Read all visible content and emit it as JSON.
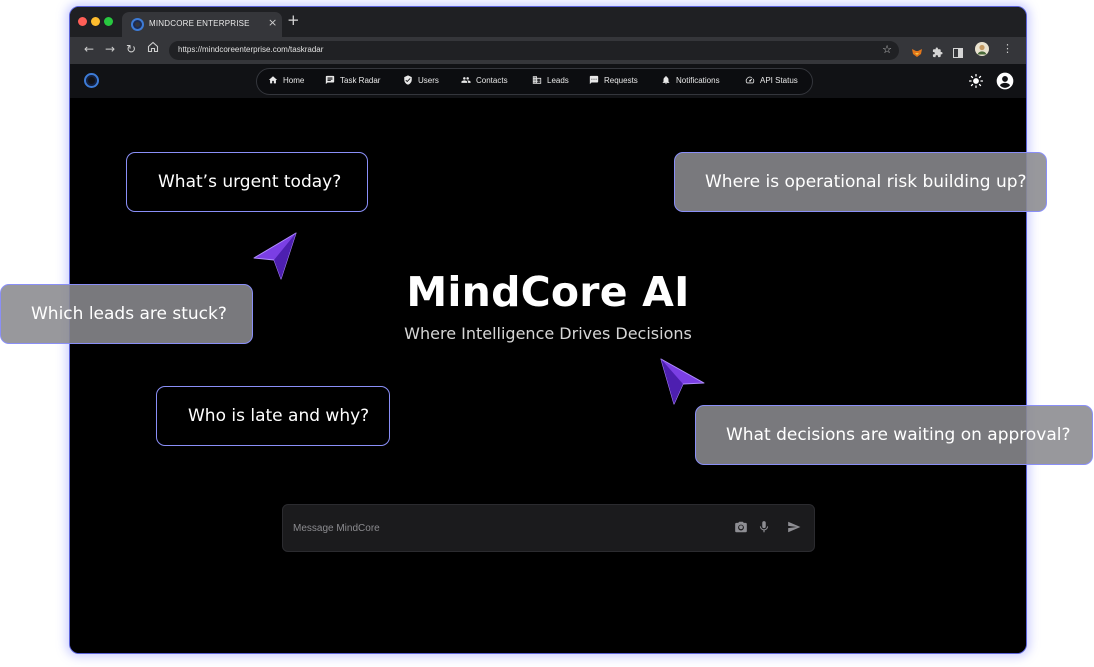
{
  "browser": {
    "tab_title": "MINDCORE ENTERPRISE",
    "tab_close": "×",
    "new_tab": "+",
    "url": "https://mindcoreenterprise.com/taskradar"
  },
  "nav": {
    "items": [
      {
        "label": "Home",
        "icon": "home-icon"
      },
      {
        "label": "Task Radar",
        "icon": "message-icon"
      },
      {
        "label": "Users",
        "icon": "shield-icon"
      },
      {
        "label": "Contacts",
        "icon": "people-icon"
      },
      {
        "label": "Leads",
        "icon": "building-icon"
      },
      {
        "label": "Requests",
        "icon": "chat-icon"
      },
      {
        "label": "Notifications",
        "icon": "bell-icon"
      },
      {
        "label": "API Status",
        "icon": "speedometer-icon"
      }
    ]
  },
  "hero": {
    "title": "MindCore AI",
    "subtitle": "Where Intelligence Drives Decisions"
  },
  "prompts": {
    "urgent": "What’s urgent today?",
    "risk": "Where is operational risk building up?",
    "leads": "Which leads are stuck?",
    "late": "Who is late and why?",
    "decisions": "What decisions are waiting on approval?"
  },
  "composer": {
    "placeholder": "Message MindCore"
  },
  "colors": {
    "accent": "#7b3fe4",
    "bubble_border": "#8a8ff7",
    "window_border": "#5b63d8"
  }
}
